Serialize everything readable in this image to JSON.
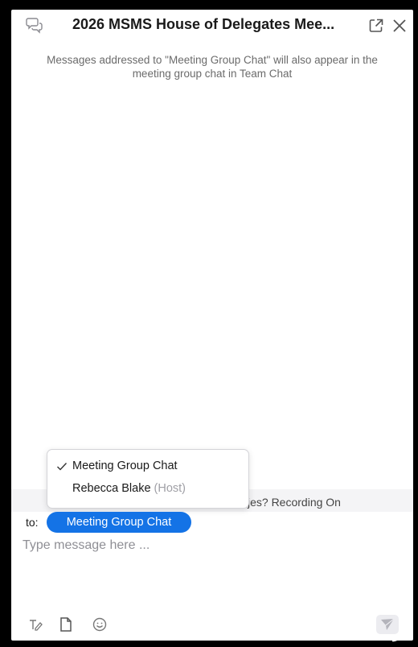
{
  "window": {
    "title": "2026 MSMS House of Delegates Mee..."
  },
  "notice": {
    "text": "Messages addressed to \"Meeting Group Chat\" will also appear in the meeting group chat in Team Chat"
  },
  "recording_banner": {
    "text": "jes? Recording On"
  },
  "recipient_dropdown": {
    "items": [
      {
        "label": "Meeting Group Chat",
        "selected": true,
        "role": ""
      },
      {
        "label": "Rebecca Blake",
        "selected": false,
        "role": "(Host)"
      }
    ]
  },
  "composer": {
    "to_label": "to:",
    "recipient": "Meeting Group Chat",
    "placeholder": "Type message here ...",
    "value": ""
  },
  "toolbar": {
    "icons": [
      "format-icon",
      "file-icon",
      "emoji-icon",
      "send-icon"
    ]
  },
  "colors": {
    "accent": "#1473e6",
    "frame": "#000000",
    "muted_text": "#6b6b6b"
  }
}
